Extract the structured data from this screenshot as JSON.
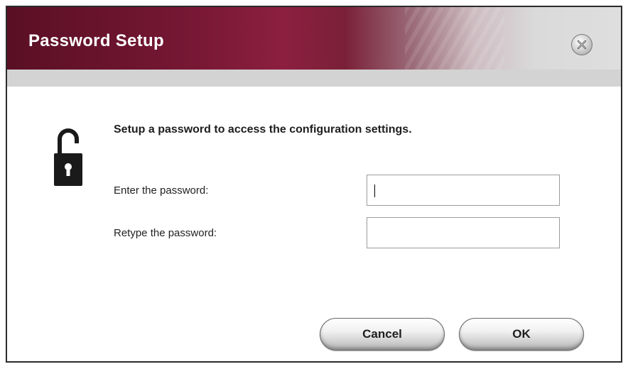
{
  "dialog": {
    "title": "Password Setup",
    "heading": "Setup a password to access the configuration settings.",
    "fields": [
      {
        "label": "Enter the password:",
        "value": ""
      },
      {
        "label": "Retype the password:",
        "value": ""
      }
    ],
    "buttons": {
      "cancel": "Cancel",
      "ok": "OK"
    }
  },
  "icons": {
    "close": "close-icon",
    "lock": "unlocked-padlock-icon"
  },
  "colors": {
    "titlebar_accent": "#741733",
    "title_text": "#ffffff",
    "subbar": "#d3d3d3"
  }
}
